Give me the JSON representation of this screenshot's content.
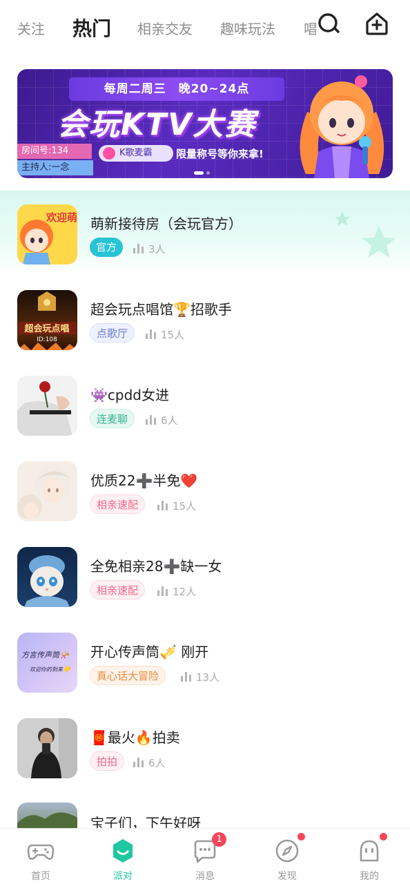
{
  "top_tabs": [
    {
      "label": "关注"
    },
    {
      "label": "热门"
    },
    {
      "label": "相亲交友"
    },
    {
      "label": "趣味玩法"
    },
    {
      "label": "唱"
    }
  ],
  "top_icons": {
    "search": "search-icon",
    "create": "add-room-icon"
  },
  "banner": {
    "schedule": "每周二周三　晚20~24点",
    "title": "会玩KTV大赛",
    "room": "房间号:134",
    "host": "主持人:一念",
    "ktv_tag": "K歌麦霸",
    "prize": "限量称号等你来拿!",
    "page_index": 1,
    "page_count": 2
  },
  "rooms": [
    {
      "title": "萌新接待房（会玩官方）",
      "tag": "官方",
      "count": "3人"
    },
    {
      "title": "超会玩点唱馆🏆招歌手",
      "tag": "点歌厅",
      "count": "15人"
    },
    {
      "title": "👾cpdd女进",
      "tag": "连麦聊",
      "count": "6人"
    },
    {
      "title": "优质22➕半免❤️",
      "tag": "相亲速配",
      "count": "15人"
    },
    {
      "title": "全免相亲28➕缺一女",
      "tag": "相亲速配",
      "count": "12人"
    },
    {
      "title": "开心传声筒🎺 刚开",
      "tag": "真心话大冒险",
      "count": "13人"
    },
    {
      "title": "🧧最火🔥拍卖",
      "tag": "拍拍",
      "count": "6人"
    },
    {
      "title": "宝子们，下午好呀",
      "tag": "",
      "count": ""
    }
  ],
  "thumb_text": {
    "welcome": "欢迎萌新",
    "ktv": "超会玩点唱",
    "ktv_id": "ID:108",
    "note_line1": "方言传声筒📯",
    "note_line2": "欢迎你的到来💛"
  },
  "nav": [
    {
      "label": "首页",
      "icon": "gamepad-icon"
    },
    {
      "label": "派对",
      "icon": "party-icon"
    },
    {
      "label": "消息",
      "icon": "message-icon",
      "badge": "1"
    },
    {
      "label": "发现",
      "icon": "compass-icon"
    },
    {
      "label": "我的",
      "icon": "profile-icon"
    }
  ],
  "colors": {
    "accent": "#1fc8a0",
    "tag_official_bg": "#29c3d6",
    "tag_song_bg": "#eef1ff",
    "tag_song_fg": "#6a7bd6",
    "tag_mic_bg": "#e6f8f2",
    "tag_mic_fg": "#2fb38e",
    "tag_date_bg": "#fff0f3",
    "tag_date_fg": "#f06a88",
    "tag_truth_bg": "#fff3ea",
    "tag_truth_fg": "#f08a3d",
    "badge": "#f5465c"
  }
}
